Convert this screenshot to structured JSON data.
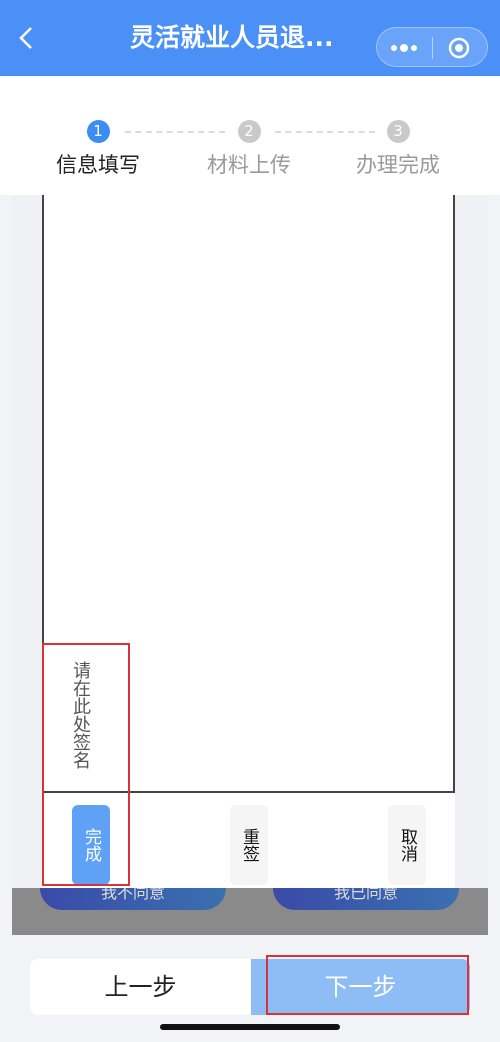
{
  "nav": {
    "title": "灵活就业人员退...",
    "icons": [
      "back-icon",
      "more-icon",
      "target-icon"
    ]
  },
  "steps": [
    {
      "num": "1",
      "label": "信息填写",
      "active": true
    },
    {
      "num": "2",
      "label": "材料上传",
      "active": false
    },
    {
      "num": "3",
      "label": "办理完成",
      "active": false
    }
  ],
  "background_buttons": [
    "我不同意",
    "我已同意"
  ],
  "signature": {
    "hint": "请在此处签名",
    "done_label": "完成",
    "resign_label": "重签",
    "cancel_label": "取消"
  },
  "footer": {
    "prev_label": "上一步",
    "next_label": "下一步"
  },
  "colors": {
    "brand": "#4a90f7",
    "active_step": "#3b8cf5",
    "done_button": "#5fa2f5",
    "next_button": "#8ebdf5",
    "highlight": "#d8323b"
  }
}
